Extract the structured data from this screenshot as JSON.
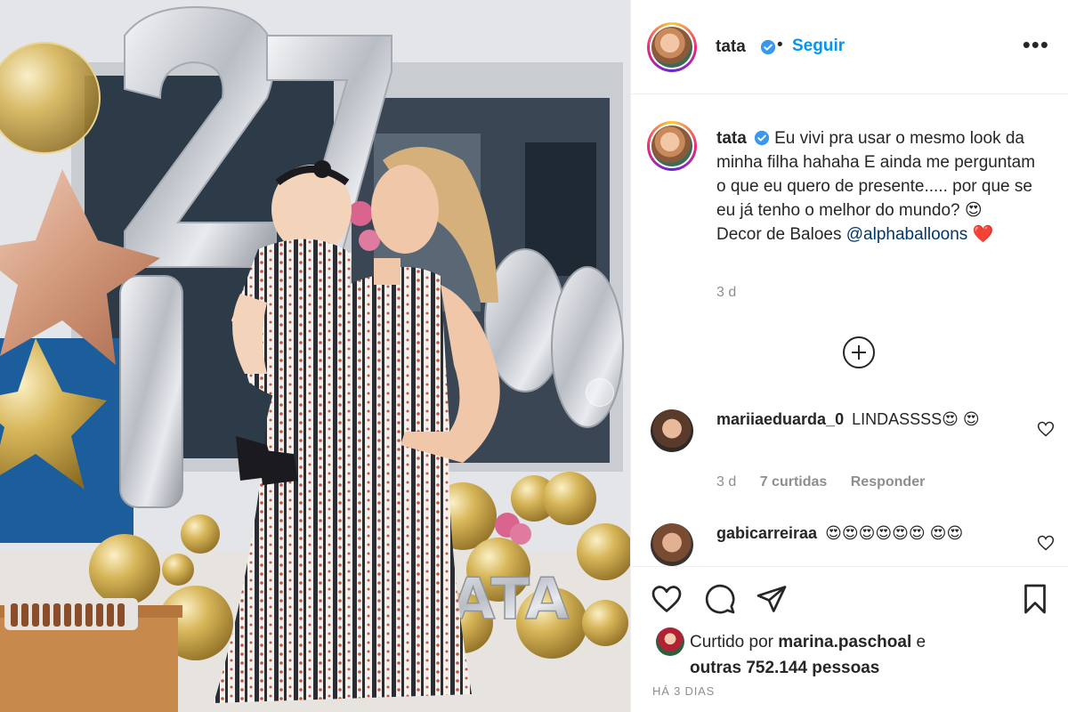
{
  "post": {
    "username": "tata",
    "follow_label": "Seguir",
    "separator": "•",
    "more_label": "•••",
    "caption": {
      "username": "tata",
      "text": "Eu vivi pra usar o mesmo look da minha filha hahaha E ainda me perguntam o que eu quero de presente..... por que se eu já tenho o melhor do mundo? 😍",
      "line2_prefix": "Decor de Baloes",
      "mention": "@alphaballoons",
      "line2_suffix": "❤️",
      "time": "3 d"
    },
    "comments": [
      {
        "username": "mariiaeduarda_0",
        "text": "LINDASSSS😍 😍",
        "time": "3 d",
        "likes": "7 curtidas",
        "reply": "Responder"
      },
      {
        "username": "gabicarreiraa",
        "text": "😍😍😍😍😍😍 😍😍",
        "time": "",
        "likes": "",
        "reply": ""
      }
    ],
    "likes": {
      "prefix": "Curtido por",
      "user": "marina.paschoal",
      "connector": "e",
      "others": "outras 752.144 pessoas"
    },
    "date": "HÁ 3 DIAS"
  },
  "photo": {
    "balloon_letters": "TATA",
    "balloon_numbers": "27"
  },
  "icons": {
    "verified": "verified-badge-icon",
    "more": "more-options-icon",
    "load_more": "plus-circle-icon",
    "like": "heart-icon",
    "comment": "comment-bubble-icon",
    "share": "paper-plane-icon",
    "save": "bookmark-icon"
  },
  "colors": {
    "accent": "#0095f6",
    "text": "#262626",
    "muted": "#8e8e8e",
    "mention": "#00376b",
    "gold": "#d4b04a",
    "silver": "#cfd3d8"
  }
}
